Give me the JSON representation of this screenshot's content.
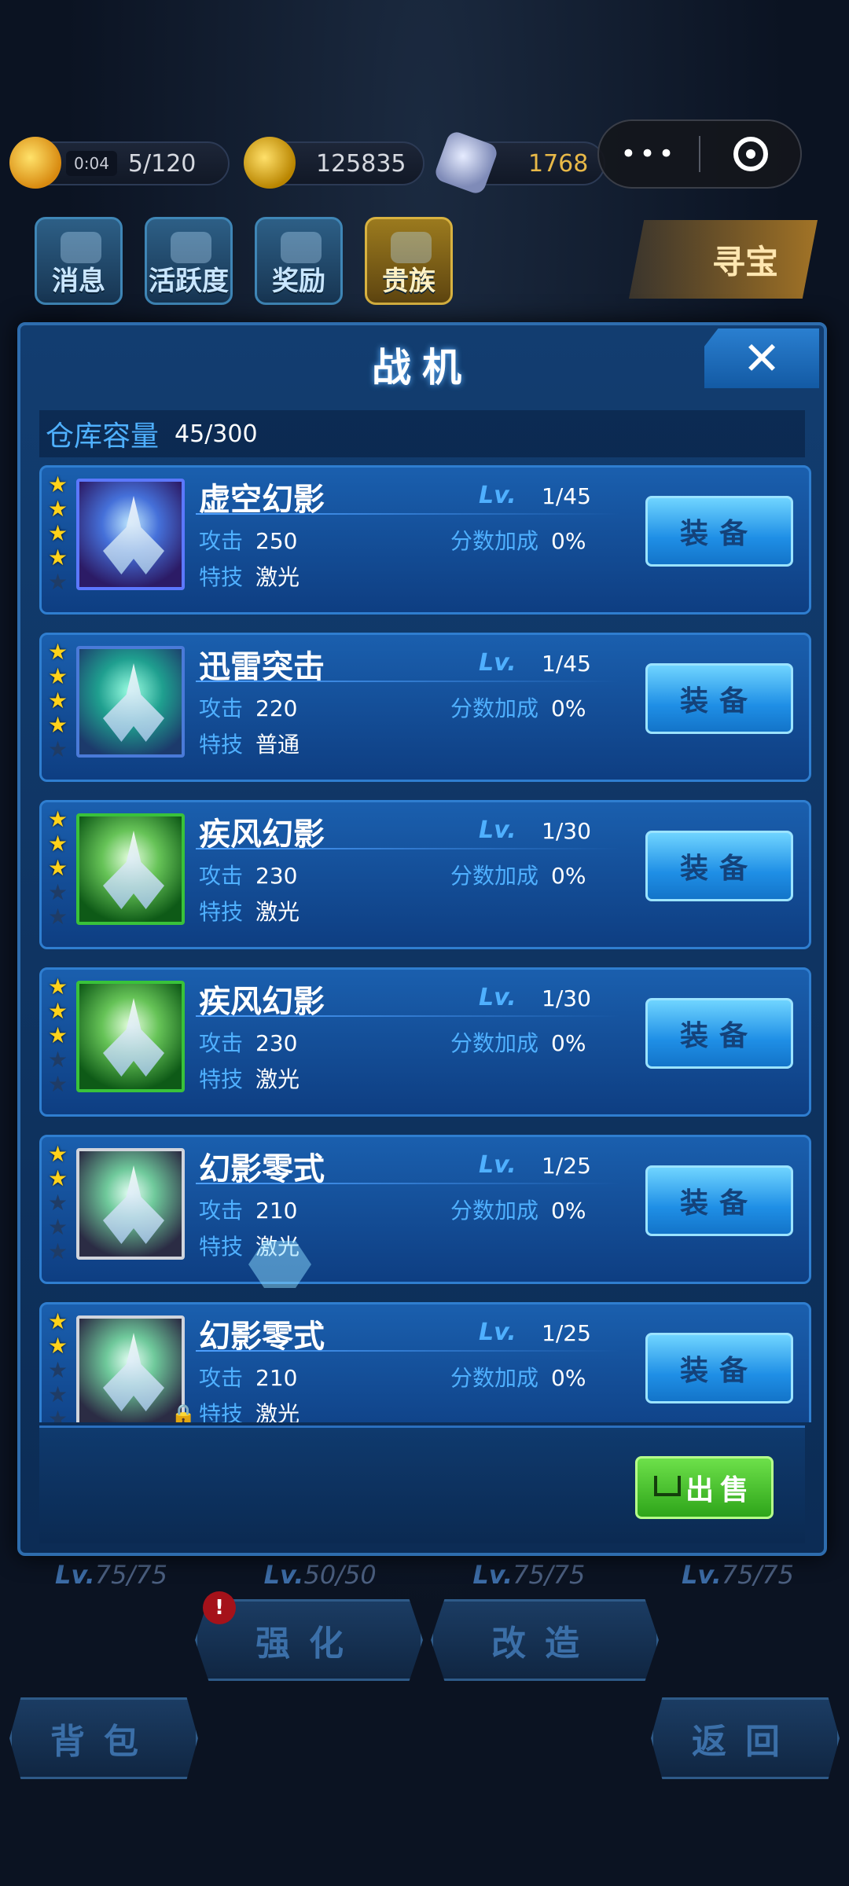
{
  "topbar": {
    "energy_timer": "0:04",
    "energy": "5/120",
    "gold": "125835",
    "gems": "1768"
  },
  "menu_capsule": {
    "more": "•••"
  },
  "top_icons": [
    {
      "label": "消息",
      "icon": "message-icon"
    },
    {
      "label": "活跃度",
      "icon": "activity-icon"
    },
    {
      "label": "奖励",
      "icon": "gift-icon"
    },
    {
      "label": "贵族",
      "icon": "vip-icon"
    }
  ],
  "treasure_label": "寻宝",
  "panel": {
    "title": "战机",
    "warehouse_label": "仓库容量",
    "warehouse_value": "45/300",
    "lv_label": "Lv.",
    "attack_label": "攻击",
    "skill_label": "特技",
    "bonus_label": "分数加成",
    "equip_label": "装备",
    "sell_label": "出售"
  },
  "planes": [
    {
      "name": "虚空幻影",
      "level": "1/45",
      "attack": "250",
      "bonus": "0%",
      "skill": "激光",
      "stars": 4,
      "theme": "purple",
      "locked": false
    },
    {
      "name": "迅雷突击",
      "level": "1/45",
      "attack": "220",
      "bonus": "0%",
      "skill": "普通",
      "stars": 4,
      "theme": "teal",
      "locked": false
    },
    {
      "name": "疾风幻影",
      "level": "1/30",
      "attack": "230",
      "bonus": "0%",
      "skill": "激光",
      "stars": 3,
      "theme": "green",
      "locked": false
    },
    {
      "name": "疾风幻影",
      "level": "1/30",
      "attack": "230",
      "bonus": "0%",
      "skill": "激光",
      "stars": 3,
      "theme": "green",
      "locked": false
    },
    {
      "name": "幻影零式",
      "level": "1/25",
      "attack": "210",
      "bonus": "0%",
      "skill": "激光",
      "stars": 2,
      "theme": "gray",
      "locked": false
    },
    {
      "name": "幻影零式",
      "level": "1/25",
      "attack": "210",
      "bonus": "0%",
      "skill": "激光",
      "stars": 2,
      "theme": "gray",
      "locked": true
    }
  ],
  "bottom": {
    "lv_items": [
      {
        "lv": "Lv.",
        "value": "75/75"
      },
      {
        "lv": "Lv.",
        "value": "50/50"
      },
      {
        "lv": "Lv.",
        "value": "75/75"
      },
      {
        "lv": "Lv.",
        "value": "75/75"
      }
    ],
    "badge": "!",
    "strengthen": "强化",
    "modify": "改造",
    "bag": "背包",
    "back": "返回"
  }
}
